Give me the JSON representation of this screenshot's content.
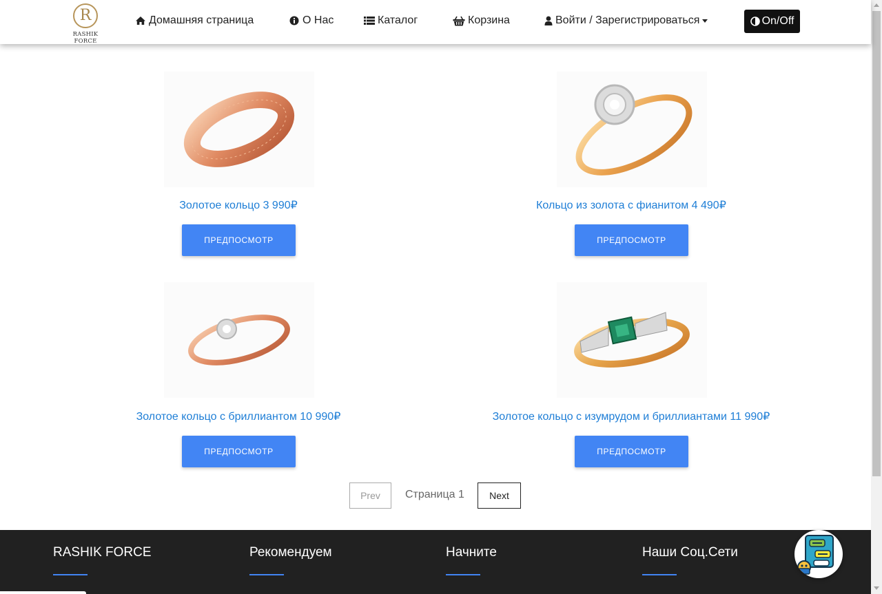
{
  "brand": {
    "name": "RASHIK FORCE",
    "mark": "R"
  },
  "nav": {
    "home": "Домашняя страница",
    "about": "О Нас",
    "catalog": "Каталог",
    "cart": "Корзина",
    "login": "Войти / Зарегистрироваться",
    "toggle": "On/Off"
  },
  "products": [
    {
      "title": "Золотое кольцо 3 990₽",
      "button": "ПРЕДПОСМОТР",
      "image": "rose-gold-faceted-band-ring"
    },
    {
      "title": "Кольцо из золота с фианитом 4 490₽",
      "button": "ПРЕДПОСМОТР",
      "image": "gold-ring-with-cubic-zirconia-flower"
    },
    {
      "title": "Золотое кольцо с бриллиантом 10 990₽",
      "button": "ПРЕДПОСМОТР",
      "image": "rose-gold-ring-with-diamond"
    },
    {
      "title": "Золотое кольцо с изумрудом и бриллиантами 11 990₽",
      "button": "ПРЕДПОСМОТР",
      "image": "gold-ring-with-emerald-and-diamonds"
    }
  ],
  "pagination": {
    "prev": "Prev",
    "label": "Страница 1",
    "next": "Next"
  },
  "footer": {
    "col1": "RASHIK FORCE",
    "col2": "Рекомендуем",
    "col3": "Начните",
    "col4": "Наши Соц.Сети"
  },
  "colors": {
    "accent": "#4285f4",
    "link": "#1e7ed6",
    "footer_bg": "#212121",
    "logo_gold": "#b7955a"
  }
}
